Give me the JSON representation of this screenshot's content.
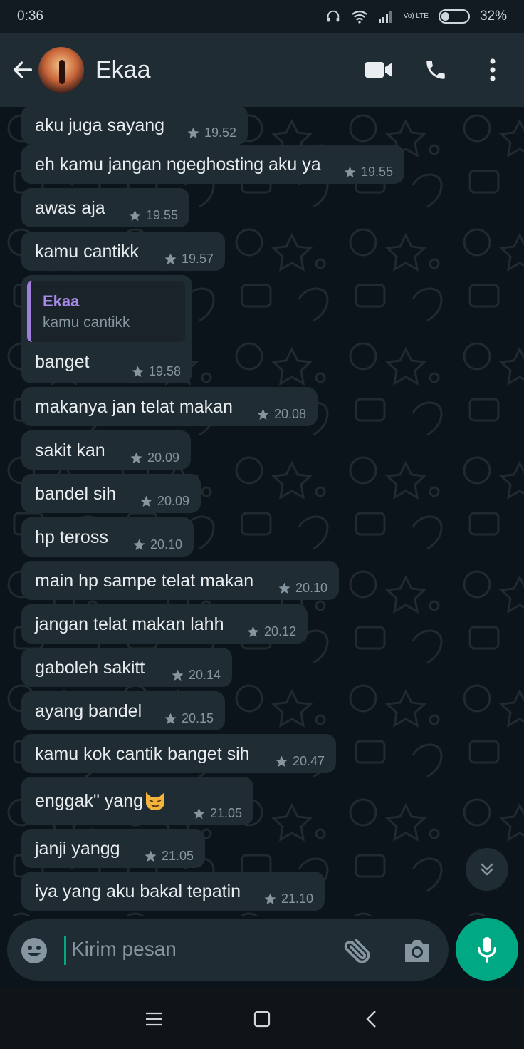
{
  "status_bar": {
    "time": "0:36",
    "network": "Vo) LTE",
    "battery": "32%",
    "battery_level": 0.32
  },
  "header": {
    "contact_name": "Ekaa"
  },
  "messages": [
    {
      "text": "aku juga sayang",
      "time": "19.52"
    },
    {
      "text": "eh kamu jangan ngeghosting aku ya",
      "time": "19.55"
    },
    {
      "text": "awas aja",
      "time": "19.55"
    },
    {
      "text": "kamu cantikk",
      "time": "19.57"
    },
    {
      "text": "banget",
      "time": "19.58",
      "quote": {
        "name": "Ekaa",
        "text": "kamu cantikk"
      }
    },
    {
      "text": "makanya jan telat makan",
      "time": "20.08"
    },
    {
      "text": "sakit kan",
      "time": "20.09"
    },
    {
      "text": "bandel sih",
      "time": "20.09"
    },
    {
      "text": "hp teross",
      "time": "20.10"
    },
    {
      "text": "main hp sampe telat makan",
      "time": "20.10"
    },
    {
      "text": "jangan telat makan lahh",
      "time": "20.12"
    },
    {
      "text": "gaboleh sakitt",
      "time": "20.14"
    },
    {
      "text": "ayang bandel",
      "time": "20.15"
    },
    {
      "text": "kamu kok cantik banget sih",
      "time": "20.47"
    },
    {
      "text": "enggak\" yang",
      "time": "21.05",
      "emoji": "smirking-cat"
    },
    {
      "text": "janji yangg",
      "time": "21.05"
    },
    {
      "text": "iya yang aku bakal tepatin",
      "time": "21.10"
    }
  ],
  "input": {
    "placeholder": "Kirim pesan"
  },
  "colors": {
    "accent": "#00a884",
    "bubble": "#202c33",
    "header": "#1f2c34",
    "background": "#0b141a",
    "quote_name": "#a68ae6"
  }
}
